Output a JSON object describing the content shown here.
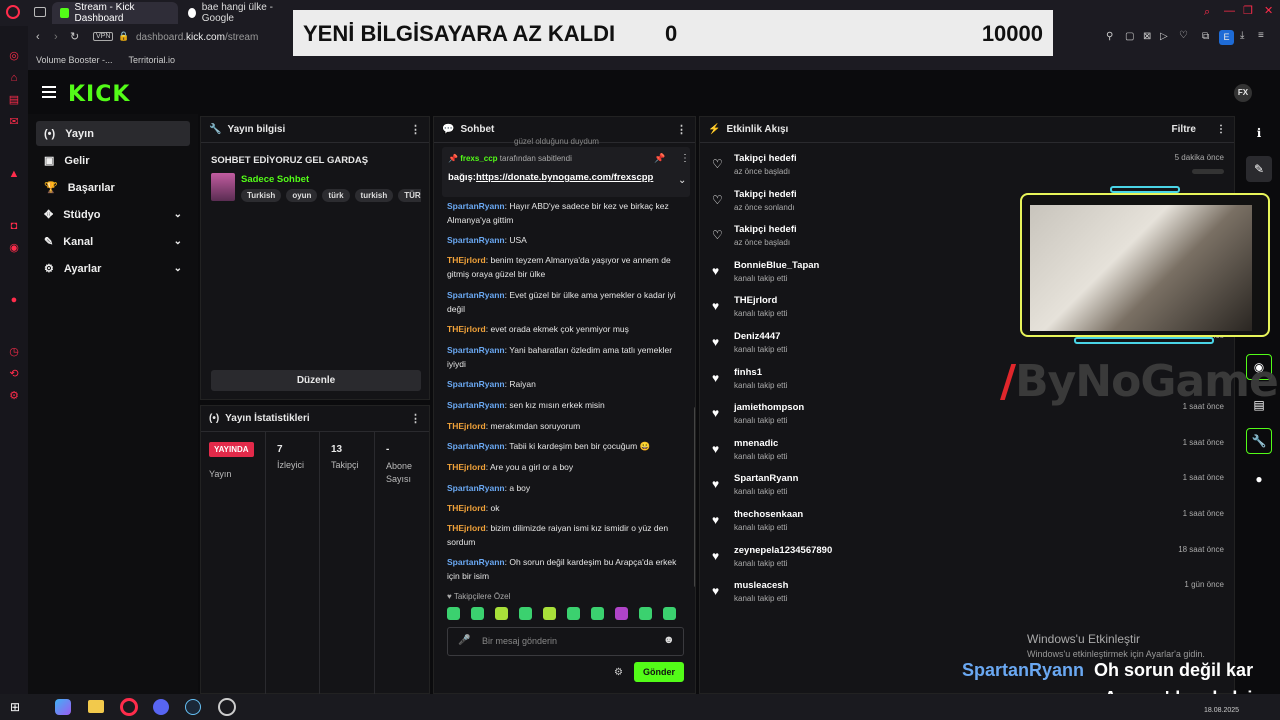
{
  "browser": {
    "tabs": [
      {
        "label": "Stream - Kick Dashboard"
      },
      {
        "label": "bae hangi ülke - Google"
      }
    ],
    "vpn": "VPN",
    "url_prefix": "dashboard.",
    "url_domain": "kick.com",
    "url_path": "/stream",
    "bookmarks": [
      {
        "label": "Volume Booster -..."
      },
      {
        "label": "Territorial.io"
      }
    ]
  },
  "banner": {
    "title": "YENİ BİLGİSAYARA AZ KALDI",
    "current": "0",
    "goal": "10000"
  },
  "kick": {
    "logo": "KICK"
  },
  "nav": {
    "items": [
      {
        "label": "Yayın",
        "icon": "broadcast-icon"
      },
      {
        "label": "Gelir",
        "icon": "revenue-icon"
      },
      {
        "label": "Başarılar",
        "icon": "trophy-icon"
      },
      {
        "label": "Stüdyo",
        "icon": "studio-icon"
      },
      {
        "label": "Kanal",
        "icon": "channel-icon"
      },
      {
        "label": "Ayarlar",
        "icon": "gear-icon"
      }
    ]
  },
  "stream_info": {
    "heading": "Yayın bilgisi",
    "title": "SOHBET EDİYORUZ GEL GARDAŞ",
    "category": "Sadece Sohbet",
    "tags": [
      "Turkish",
      "oyun",
      "türk",
      "turkish",
      "TÜRK"
    ],
    "edit_label": "Düzenle"
  },
  "stats": {
    "heading": "Yayın İstatistikleri",
    "live_badge": "YAYINDA",
    "cells": [
      {
        "value": "",
        "label": "Yayın"
      },
      {
        "value": "7",
        "label": "İzleyici"
      },
      {
        "value": "13",
        "label": "Takipçi"
      },
      {
        "value": "-",
        "label": "Abone Sayısı"
      }
    ]
  },
  "chat": {
    "heading": "Sohbet",
    "prev_line": "güzel olduğunu duydum",
    "pinned_user": "frexs_ccp",
    "pinned_suffix": "tarafından sabitlendi",
    "pinned_prefix": "bağış:",
    "pinned_link": "https://donate.bynogame.com/frexscpp",
    "messages": [
      {
        "user": "SpartanRyann",
        "text": "Hayır ABD'ye sadece bir kez ve birkaç kez Almanya'ya gittim"
      },
      {
        "user": "SpartanRyann",
        "text": "USA"
      },
      {
        "user": "THEjrlord",
        "text": "benim teyzem Almanya'da yaşıyor ve annem de gitmiş oraya güzel bir ülke"
      },
      {
        "user": "SpartanRyann",
        "text": "Evet güzel bir ülke ama yemekler o kadar iyi değil"
      },
      {
        "user": "THEjrlord",
        "text": "evet orada ekmek çok yenmiyor muş"
      },
      {
        "user": "SpartanRyann",
        "text": "Yani baharatları özledim ama tatlı yemekler iyiydi"
      },
      {
        "user": "SpartanRyann",
        "text": "Raiyan"
      },
      {
        "user": "SpartanRyann",
        "text": "sen kız mısın erkek misin"
      },
      {
        "user": "THEjrlord",
        "text": "merakımdan soruyorum"
      },
      {
        "user": "SpartanRyann",
        "text": "Tabii ki kardeşim ben bir çocuğum 😀"
      },
      {
        "user": "THEjrlord",
        "text": "Are you a girl or a boy"
      },
      {
        "user": "SpartanRyann",
        "text": "a boy"
      },
      {
        "user": "THEjrlord",
        "text": "ok"
      },
      {
        "user": "THEjrlord",
        "text": "bizim dilimizde raiyan ismi kız ismidir o yüz den sordum"
      },
      {
        "user": "SpartanRyann",
        "text": "Oh sorun değil kardeşim bu Arapça'da erkek için bir isim"
      }
    ],
    "followers_only": "Takipçilere Özel",
    "input_placeholder": "Bir mesaj gönderin",
    "send_label": "Gönder"
  },
  "activity": {
    "heading": "Etkinlik Akışı",
    "filter_label": "Filtre",
    "items": [
      {
        "name": "Takipçi hedefi",
        "sub": "az önce başladı",
        "time": "5 dakika önce",
        "kind": "goal"
      },
      {
        "name": "Takipçi hedefi",
        "sub": "az önce sonlandı",
        "time": "",
        "kind": "goal"
      },
      {
        "name": "Takipçi hedefi",
        "sub": "az önce başladı",
        "time": "",
        "kind": "goal"
      },
      {
        "name": "BonnieBlue_Tapan",
        "sub": "kanalı takip etti",
        "time": "",
        "kind": "follow"
      },
      {
        "name": "THEjrlord",
        "sub": "kanalı takip etti",
        "time": "",
        "kind": "follow"
      },
      {
        "name": "Deniz4447",
        "sub": "kanalı takip etti",
        "time": "1 saat önce",
        "kind": "follow"
      },
      {
        "name": "finhs1",
        "sub": "kanalı takip etti",
        "time": "",
        "kind": "follow"
      },
      {
        "name": "jamiethompson",
        "sub": "kanalı takip etti",
        "time": "1 saat önce",
        "kind": "follow"
      },
      {
        "name": "mnenadic",
        "sub": "kanalı takip etti",
        "time": "1 saat önce",
        "kind": "follow"
      },
      {
        "name": "SpartanRyann",
        "sub": "kanalı takip etti",
        "time": "1 saat önce",
        "kind": "follow"
      },
      {
        "name": "thechosenkaan",
        "sub": "kanalı takip etti",
        "time": "1 saat önce",
        "kind": "follow"
      },
      {
        "name": "zeynepela1234567890",
        "sub": "kanalı takip etti",
        "time": "18 saat önce",
        "kind": "follow"
      },
      {
        "name": "musleacesh",
        "sub": "kanalı takip etti",
        "time": "1 gün önce",
        "kind": "follow"
      }
    ]
  },
  "overlay": {
    "watermark": "ByNoGame",
    "windows_activate_title": "Windows'u Etkinleştir",
    "windows_activate_sub": "Windows'u etkinleştirmek için Ayarlar'a gidin.",
    "chat_user": "SpartanRyann",
    "chat_line1": "Oh sorun değil kar",
    "chat_line2": "Arapça'da erkek iç"
  },
  "taskbar": {
    "date": "18.08.2025"
  }
}
